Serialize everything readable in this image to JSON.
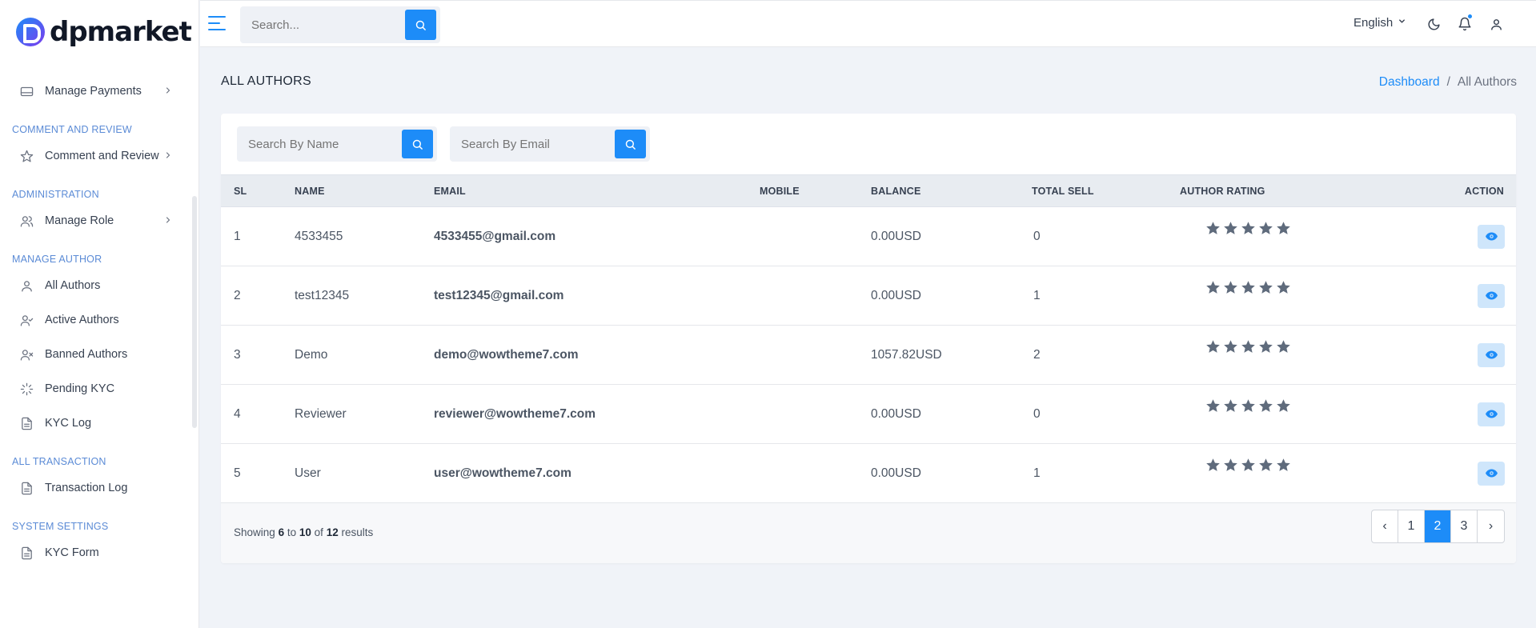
{
  "brand": {
    "name": "dpmarket"
  },
  "sidebar": {
    "items": [
      {
        "type": "item",
        "label": "Manage Payments",
        "icon": "credit-card-icon",
        "chevron": true
      },
      {
        "type": "section",
        "label": "COMMENT AND REVIEW"
      },
      {
        "type": "item",
        "label": "Comment and Review",
        "icon": "star-icon",
        "chevron": true
      },
      {
        "type": "section",
        "label": "ADMINISTRATION"
      },
      {
        "type": "item",
        "label": "Manage Role",
        "icon": "users-icon",
        "chevron": true
      },
      {
        "type": "section",
        "label": "MANAGE AUTHOR"
      },
      {
        "type": "item",
        "label": "All Authors",
        "icon": "user-icon"
      },
      {
        "type": "item",
        "label": "Active Authors",
        "icon": "user-check-icon"
      },
      {
        "type": "item",
        "label": "Banned Authors",
        "icon": "user-x-icon"
      },
      {
        "type": "item",
        "label": "Pending KYC",
        "icon": "loader-icon"
      },
      {
        "type": "item",
        "label": "KYC Log",
        "icon": "file-text-icon"
      },
      {
        "type": "section",
        "label": "ALL TRANSACTION"
      },
      {
        "type": "item",
        "label": "Transaction Log",
        "icon": "file-text-icon"
      },
      {
        "type": "section",
        "label": "SYSTEM SETTINGS"
      },
      {
        "type": "item",
        "label": "KYC Form",
        "icon": "file-text-icon"
      }
    ]
  },
  "topbar": {
    "search_placeholder": "Search...",
    "language": "English",
    "icons": [
      "menu-icon",
      "search-icon",
      "chevron-down-icon",
      "moon-icon",
      "bell-icon",
      "user-icon"
    ]
  },
  "page": {
    "title": "ALL AUTHORS",
    "breadcrumb": {
      "home": "Dashboard",
      "separator": "/",
      "current": "All Authors"
    }
  },
  "filters": {
    "name_placeholder": "Search By Name",
    "email_placeholder": "Search By Email"
  },
  "table": {
    "columns": [
      "SL",
      "NAME",
      "EMAIL",
      "MOBILE",
      "BALANCE",
      "TOTAL SELL",
      "AUTHOR RATING",
      "ACTION"
    ],
    "rows": [
      {
        "sl": "1",
        "name": "4533455",
        "email": "4533455@gmail.com",
        "mobile": "",
        "balance": "0.00USD",
        "total_sell": "0",
        "rating": 5
      },
      {
        "sl": "2",
        "name": "test12345",
        "email": "test12345@gmail.com",
        "mobile": "",
        "balance": "0.00USD",
        "total_sell": "1",
        "rating": 5
      },
      {
        "sl": "3",
        "name": "Demo",
        "email": "demo@wowtheme7.com",
        "mobile": "",
        "balance": "1057.82USD",
        "total_sell": "2",
        "rating": 5
      },
      {
        "sl": "4",
        "name": "Reviewer",
        "email": "reviewer@wowtheme7.com",
        "mobile": "",
        "balance": "0.00USD",
        "total_sell": "0",
        "rating": 5
      },
      {
        "sl": "5",
        "name": "User",
        "email": "user@wowtheme7.com",
        "mobile": "",
        "balance": "0.00USD",
        "total_sell": "1",
        "rating": 5
      }
    ]
  },
  "pagination": {
    "showing_prefix": "Showing",
    "from": "6",
    "to_word": "to",
    "to": "10",
    "of_word": "of",
    "total": "12",
    "results_word": "results",
    "prev": "‹",
    "next": "›",
    "pages": [
      "1",
      "2",
      "3"
    ],
    "active_page": "2"
  },
  "colors": {
    "accent": "#1d8cf8",
    "star": "#5f6b7c",
    "view_button_bg": "#cfe6fb"
  }
}
